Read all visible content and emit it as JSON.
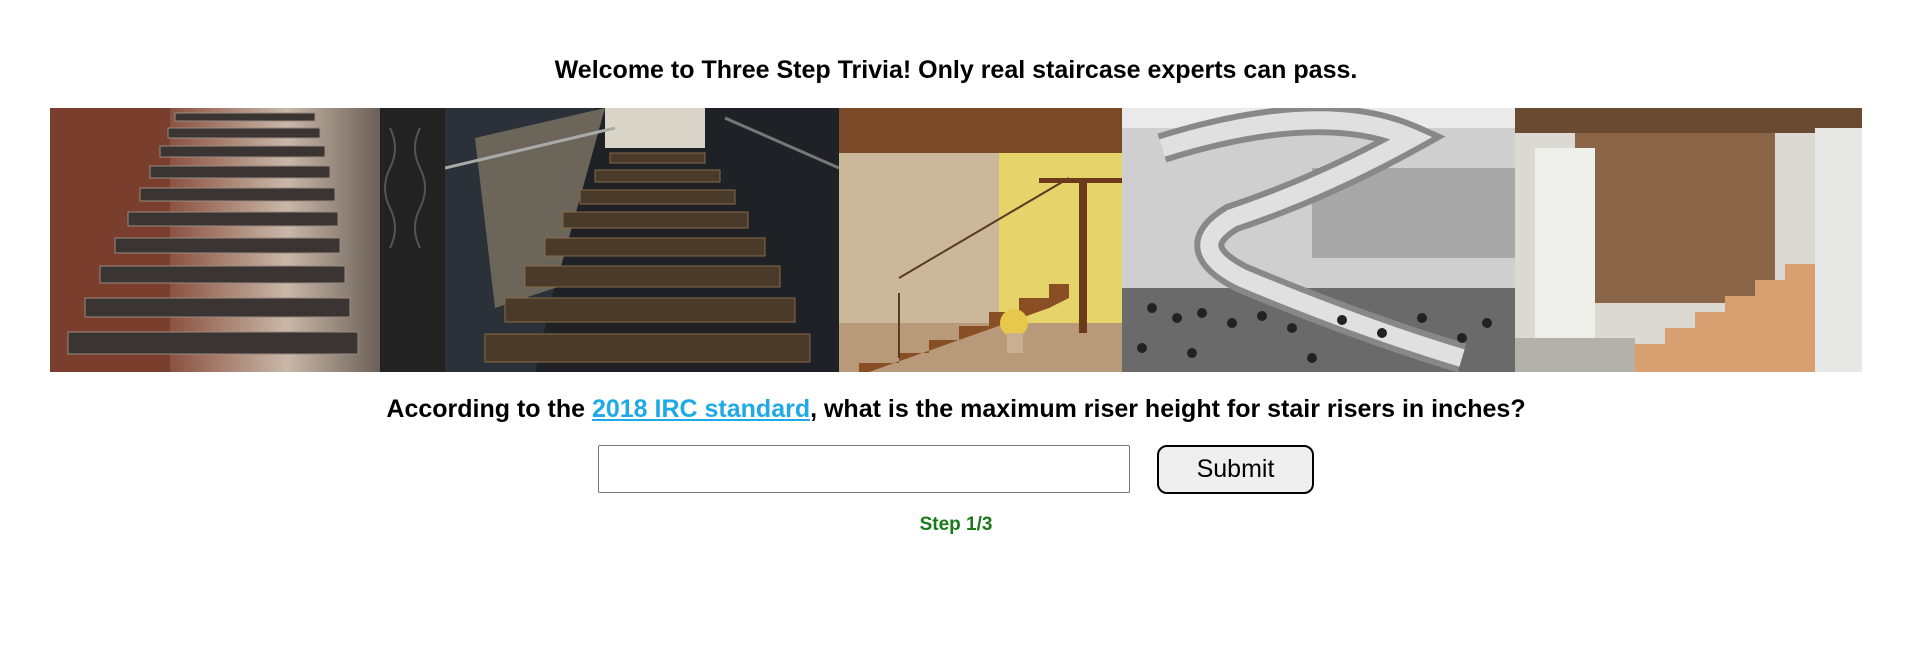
{
  "header": {
    "welcome_text": "Welcome to Three Step Trivia! Only real staircase experts can pass."
  },
  "banner": {
    "photos": [
      "brick-staircase-photo",
      "dark-modern-staircase-photo",
      "wooden-interior-staircase-photo",
      "spiral-staircase-photo",
      "unfinished-staircase-photo"
    ]
  },
  "question": {
    "prefix": "According to the ",
    "link_text": "2018 IRC standard",
    "suffix": ", what is the maximum riser height for stair risers in inches?"
  },
  "form": {
    "answer_value": "",
    "answer_placeholder": "",
    "submit_label": "Submit"
  },
  "progress": {
    "step_text": "Step 1/3"
  },
  "colors": {
    "link": "#1fa9e6",
    "step": "#1a7a1a",
    "button_bg": "#efefef"
  }
}
